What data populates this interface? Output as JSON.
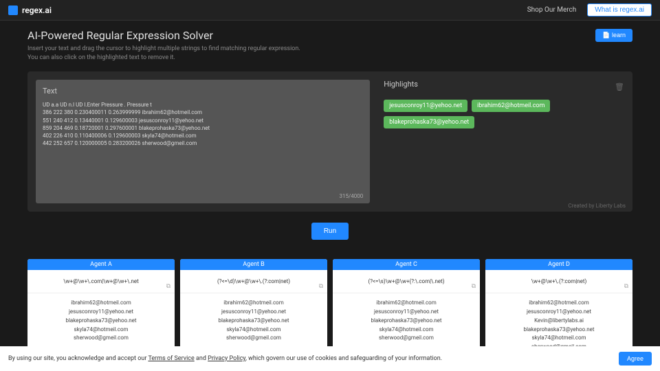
{
  "header": {
    "logo_text": "regex.ai",
    "shop_link": "Shop Our Merch",
    "what_is_btn": "What is regex.ai"
  },
  "page": {
    "title": "AI-Powered Regular Expression Solver",
    "subtitle_line1": "Insert your text and drag the cursor to highlight multiple strings to find matching regular expression.",
    "subtitle_line2": "You can also click on the highlighted text to remove it.",
    "learn_btn": "📄 learn"
  },
  "text_panel": {
    "label": "Text",
    "content": "UD a.a UD n.l UD l.Enter Pressure . Pressure t\n386 222 380 0.230400011 0.263999999 ibrahim62@hotmeil.com\n551 240 412 0.13440001 0.129600003 jesusconroy11@yehoo.net\n859 204 469 0.18720001 0.297600001 blakeprohaska73@yehoo.net\n402 226 410 0.110400006 0.129600003 skyla74@hotmeil.com\n442 252 657 0.120000005 0.283200026 sherwood@gmeil.com",
    "char_count": "315/4000"
  },
  "highlights_panel": {
    "label": "Highlights",
    "chips": [
      "jesusconroy11@yehoo.net",
      "ibrahim62@hotmeil.com",
      "blakeprohaska73@yehoo.net"
    ]
  },
  "credit": "Created by Liberty Labs",
  "run_btn": "Run",
  "agents": [
    {
      "name": "Agent A",
      "regex": "\\w+@\\w+\\.com|\\w+@\\w+\\.net",
      "matches": [
        "ibrahim62@hotmeil.com",
        "jesusconroy11@yehoo.net",
        "blakeprohaska73@yehoo.net",
        "skyla74@hotmeil.com",
        "sherwood@gmeil.com"
      ]
    },
    {
      "name": "Agent B",
      "regex": "(?<=\\d)\\w+@\\w+\\.(?:com|net)",
      "matches": [
        "ibrahim62@hotmeil.com",
        "jesusconroy11@yehoo.net",
        "blakeprohaska73@yehoo.net",
        "skyla74@hotmeil.com",
        "sherwood@gmeil.com"
      ]
    },
    {
      "name": "Agent C",
      "regex": "(?<=\\s)\\w+@\\w+(?:\\.com|\\.net)",
      "matches": [
        "ibrahim62@hotmeil.com",
        "jesusconroy11@yehoo.net",
        "blakeprohaska73@yehoo.net",
        "skyla74@hotmeil.com",
        "sherwood@gmeil.com"
      ]
    },
    {
      "name": "Agent D",
      "regex": "\\w+@\\w+\\.(?:com|net)",
      "matches": [
        "ibrahim62@hotmeil.com",
        "jesusconroy11@yehoo.net",
        "Kevin@libertylabs.ai",
        "blakeprohaska73@yehoo.net",
        "skyla74@hotmeil.com",
        "sherwood@gmeil.com"
      ]
    }
  ],
  "cookie": {
    "text_prefix": "By using our site, you acknowledge and accept our ",
    "tos": "Terms of Service",
    "and": " and ",
    "privacy": "Privacy Policy",
    "text_suffix": ", which govern our use of cookies and safeguarding of your information.",
    "agree_btn": "Agree"
  }
}
